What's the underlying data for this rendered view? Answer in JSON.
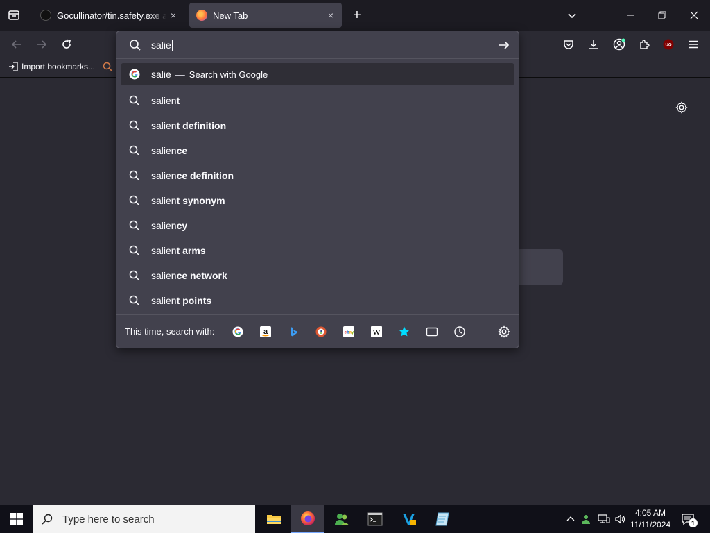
{
  "tabs": [
    {
      "title": "Gocullinator/tin.safety.exe at m",
      "close": "×"
    },
    {
      "title": "New Tab",
      "close": "×"
    }
  ],
  "newtab_label": "+",
  "bookmarks": {
    "import_label": "Import bookmarks..."
  },
  "urlbar": {
    "input_value": "salie",
    "heuristic": {
      "typed": "salie",
      "separator": "—",
      "action": "Search with Google"
    },
    "suggestions": [
      {
        "prefix": "salien",
        "suffix": "t"
      },
      {
        "prefix": "salien",
        "suffix": "t definition"
      },
      {
        "prefix": "salien",
        "suffix": "ce"
      },
      {
        "prefix": "salien",
        "suffix": "ce definition"
      },
      {
        "prefix": "salien",
        "suffix": "t synonym"
      },
      {
        "prefix": "salien",
        "suffix": "cy"
      },
      {
        "prefix": "salien",
        "suffix": "t arms"
      },
      {
        "prefix": "salien",
        "suffix": "ce network"
      },
      {
        "prefix": "salien",
        "suffix": "t points"
      }
    ],
    "oneoff_label": "This time, search with:",
    "engines": [
      "google-icon",
      "amazon-icon",
      "bing-icon",
      "duckduckgo-icon",
      "ebay-icon",
      "wikipedia-icon",
      "bookmarks-icon",
      "tabs-icon",
      "history-icon"
    ]
  },
  "taskbar": {
    "search_placeholder": "Type here to search",
    "time": "4:05 AM",
    "date": "11/11/2024",
    "notification_count": "1"
  },
  "colors": {
    "accent": "#78a9ff",
    "toolbar": "#2b2a33",
    "tabstrip": "#1c1b22",
    "panel": "#42414d"
  }
}
